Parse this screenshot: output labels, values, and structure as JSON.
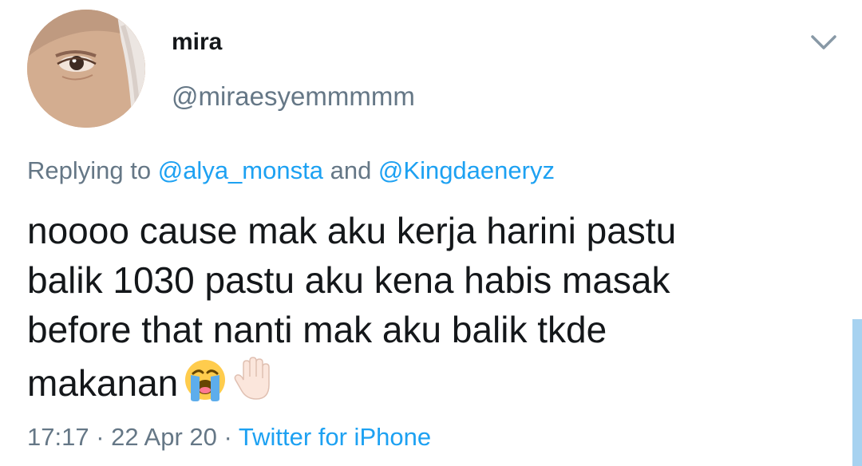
{
  "author": {
    "display_name": "mira",
    "handle": "@miraesyemmmmm"
  },
  "reply": {
    "prefix": "Replying to ",
    "mention_1": "@alya_monsta",
    "joiner": " and ",
    "mention_2": "@Kingdaeneryz"
  },
  "tweet": {
    "lines": [
      "noooo cause mak aku kerja harini pastu",
      "balik 1030 pastu aku kena habis masak",
      "before that nanti mak aku balik tkde",
      "makanan"
    ],
    "emojis": [
      "loudly-crying-face-emoji",
      "raised-hand-emoji"
    ]
  },
  "meta": {
    "time": "17:17",
    "separator": " · ",
    "date": "22 Apr 20",
    "source": "Twitter for iPhone"
  },
  "icons": {
    "menu": "chevron-down-icon"
  },
  "colors": {
    "link": "#1da1f2",
    "secondary_text": "#657786",
    "primary_text": "#14171a",
    "scroll_indicator": "#a7d2f0"
  }
}
